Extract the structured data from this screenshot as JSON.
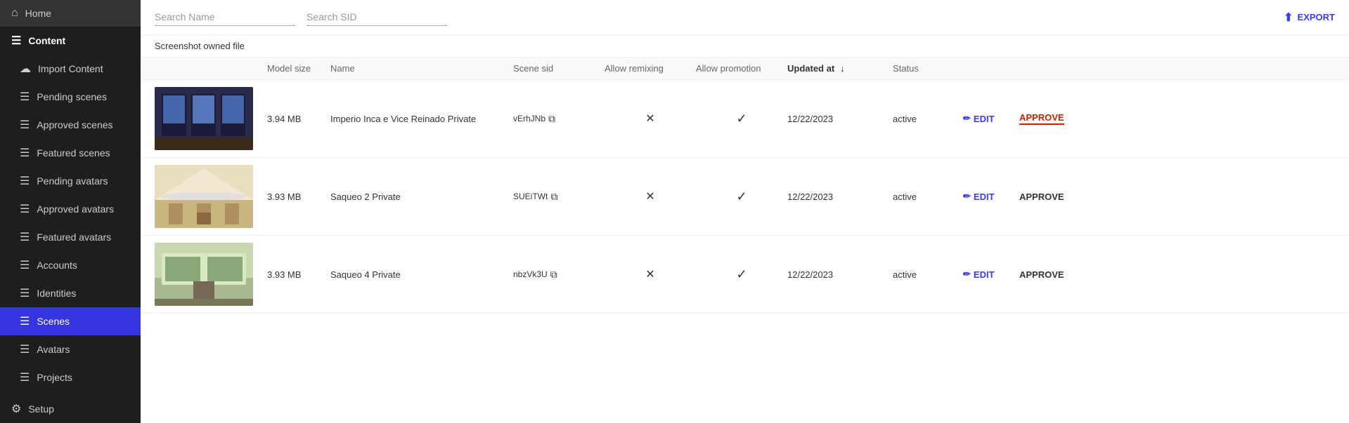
{
  "sidebar": {
    "items": [
      {
        "id": "home",
        "label": "Home",
        "icon": "⌂",
        "active": false
      },
      {
        "id": "content",
        "label": "Content",
        "icon": "☰",
        "active": false,
        "section": true
      },
      {
        "id": "import-content",
        "label": "Import Content",
        "icon": "↑",
        "active": false,
        "indent": true
      },
      {
        "id": "pending-scenes",
        "label": "Pending scenes",
        "icon": "☰",
        "active": false,
        "indent": true
      },
      {
        "id": "approved-scenes",
        "label": "Approved scenes",
        "icon": "☰",
        "active": false,
        "indent": true
      },
      {
        "id": "featured-scenes",
        "label": "Featured scenes",
        "icon": "☰",
        "active": false,
        "indent": true
      },
      {
        "id": "pending-avatars",
        "label": "Pending avatars",
        "icon": "☰",
        "active": false,
        "indent": true
      },
      {
        "id": "approved-avatars",
        "label": "Approved avatars",
        "icon": "☰",
        "active": false,
        "indent": true
      },
      {
        "id": "featured-avatars",
        "label": "Featured avatars",
        "icon": "☰",
        "active": false,
        "indent": true
      },
      {
        "id": "accounts",
        "label": "Accounts",
        "icon": "☰",
        "active": false,
        "indent": true
      },
      {
        "id": "identities",
        "label": "Identities",
        "icon": "☰",
        "active": false,
        "indent": true
      },
      {
        "id": "scenes",
        "label": "Scenes",
        "icon": "☰",
        "active": true,
        "indent": true
      },
      {
        "id": "avatars",
        "label": "Avatars",
        "icon": "☰",
        "active": false,
        "indent": true
      },
      {
        "id": "projects",
        "label": "Projects",
        "icon": "☰",
        "active": false,
        "indent": true
      },
      {
        "id": "setup",
        "label": "Setup",
        "icon": "⚙",
        "active": false
      }
    ]
  },
  "topbar": {
    "search_name_placeholder": "Search Name",
    "search_sid_placeholder": "Search SID",
    "export_label": "EXPORT"
  },
  "subbar": {
    "screenshot_label": "Screenshot owned file"
  },
  "table": {
    "headers": [
      {
        "id": "screenshot",
        "label": ""
      },
      {
        "id": "model-size",
        "label": "Model size"
      },
      {
        "id": "name",
        "label": "Name"
      },
      {
        "id": "scene-sid",
        "label": "Scene sid"
      },
      {
        "id": "allow-remixing",
        "label": "Allow remixing"
      },
      {
        "id": "allow-promotion",
        "label": "Allow promotion"
      },
      {
        "id": "updated-at",
        "label": "Updated at",
        "sortable": true,
        "sort_icon": "↓"
      },
      {
        "id": "status",
        "label": "Status"
      },
      {
        "id": "edit",
        "label": ""
      },
      {
        "id": "approve",
        "label": ""
      }
    ],
    "rows": [
      {
        "id": "row-1",
        "thumb_color": "#2a2a4a",
        "model_size": "3.94 MB",
        "name": "Imperio Inca e Vice Reinado Private",
        "scene_sid": "vErhJNb",
        "allow_remixing": false,
        "allow_promotion": true,
        "updated_at": "12/22/2023",
        "status": "active",
        "edit_label": "EDIT",
        "approve_label": "APPROVE",
        "approve_highlighted": true
      },
      {
        "id": "row-2",
        "thumb_color": "#d4c8a0",
        "model_size": "3.93 MB",
        "name": "Saqueo 2 Private",
        "scene_sid": "SUEiTWt",
        "allow_remixing": false,
        "allow_promotion": true,
        "updated_at": "12/22/2023",
        "status": "active",
        "edit_label": "EDIT",
        "approve_label": "APPROVE",
        "approve_highlighted": false
      },
      {
        "id": "row-3",
        "thumb_color": "#b8c8a8",
        "model_size": "3.93 MB",
        "name": "Saqueo 4 Private",
        "scene_sid": "nbzVk3U",
        "allow_remixing": false,
        "allow_promotion": true,
        "updated_at": "12/22/2023",
        "status": "active",
        "edit_label": "EDIT",
        "approve_label": "APPROVE",
        "approve_highlighted": false
      }
    ]
  },
  "icons": {
    "home": "⌂",
    "content": "☰",
    "import": "☁",
    "list": "☰",
    "gear": "⚙",
    "edit": "✏",
    "export": "⬆",
    "external": "⧉",
    "sort_desc": "↓",
    "check": "✓",
    "cross": "✕"
  },
  "colors": {
    "sidebar_bg": "#1e1e1e",
    "active_item": "#3535e0",
    "edit_color": "#3535e0",
    "approve_highlighted": "#cc2200",
    "approve_plain": "#333333"
  }
}
